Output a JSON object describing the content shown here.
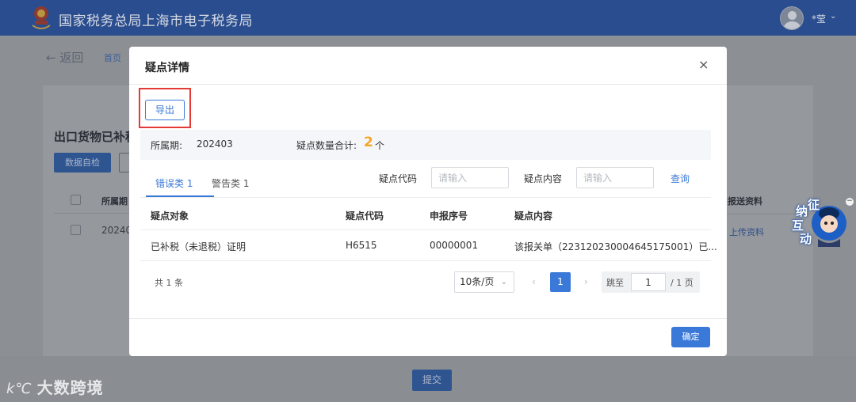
{
  "header": {
    "site_title": "国家税务总局上海市电子税务局",
    "user_name": "*莹"
  },
  "background": {
    "back_label": "返回",
    "breadcrumb_home": "首页",
    "section_title": "出口货物已补税",
    "data_check_button": "数据自检",
    "table_header_period": "所属期",
    "table_cell_period": "20240",
    "table_header_report": "报送资料",
    "upload_link": "上传资料",
    "submit_button": "提交"
  },
  "watermark": {
    "logo": "k℃",
    "text": "大数跨境"
  },
  "mascot": {
    "chars": [
      "征",
      "纳",
      "互",
      "动"
    ],
    "close_glyph": "−"
  },
  "modal": {
    "title": "疑点详情",
    "close_glyph": "×",
    "export_button": "导出",
    "summary": {
      "period_label": "所属期:",
      "period_value": "202403",
      "count_label": "疑点数量合计:",
      "count_value": "2",
      "count_unit": "个"
    },
    "tabs": [
      {
        "label": "错误类 1",
        "active": true
      },
      {
        "label": "警告类 1",
        "active": false
      }
    ],
    "filters": {
      "code_label": "疑点代码",
      "code_placeholder": "请输入",
      "content_label": "疑点内容",
      "content_placeholder": "请输入",
      "query_button": "查询"
    },
    "table": {
      "headers": [
        "疑点对象",
        "疑点代码",
        "申报序号",
        "疑点内容"
      ],
      "rows": [
        [
          "已补税（未退税）证明",
          "H6515",
          "00000001",
          "该报关单（223120230004645175001）已..."
        ]
      ]
    },
    "pagination": {
      "total_text": "共 1 条",
      "page_size": "10条/页",
      "prev": "‹",
      "current_page": "1",
      "next": "›",
      "jump_label": "跳至",
      "jump_value": "1",
      "total_pages": "/ 1 页"
    },
    "confirm_button": "确定"
  },
  "colors": {
    "topbar": "#2a4d8f",
    "primary": "#3b79d8",
    "highlight_frame": "#e53935",
    "count_accent": "#f5a623"
  }
}
